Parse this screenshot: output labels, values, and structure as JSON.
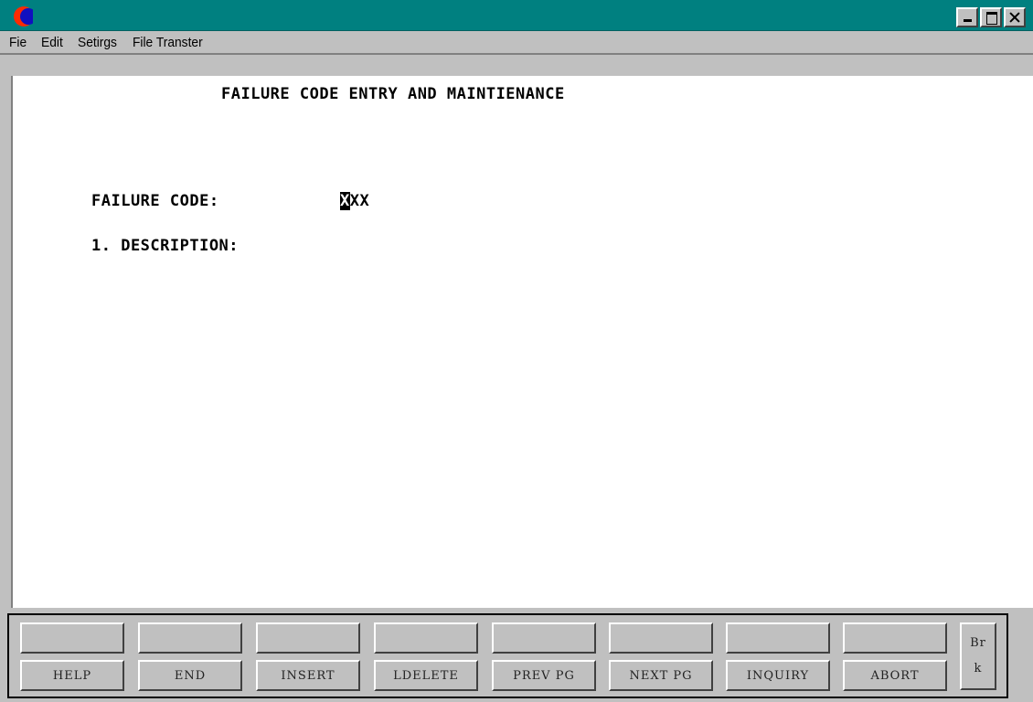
{
  "window": {
    "icon": "crescent-app-icon",
    "controls": [
      "minimize-icon",
      "maximize-icon",
      "close-icon"
    ]
  },
  "menu": {
    "items": [
      "Fie",
      "Edit",
      "Setirgs",
      "File Transter"
    ]
  },
  "screen": {
    "title": "FAILURE CODE ENTRY AND MAINTIENANCE",
    "failure_code_label": "FAILURE CODE:",
    "failure_code_cursor": "X",
    "failure_code_value": "XX",
    "description_label": "1. DESCRIPTION:"
  },
  "function_keys": {
    "top_row": [
      "",
      "",
      "",
      "",
      "",
      "",
      "",
      ""
    ],
    "bottom_row": [
      "HELP",
      "END",
      "INSERT",
      "LDELETE",
      "PREV PG",
      "NEXT PG",
      "INQUIRY",
      "ABORT"
    ],
    "brk_line1": "Br",
    "brk_line2": "k"
  },
  "colors": {
    "titlebar": "#008080",
    "window_bg": "#c0c0c0",
    "screen_bg": "#ffffff"
  }
}
